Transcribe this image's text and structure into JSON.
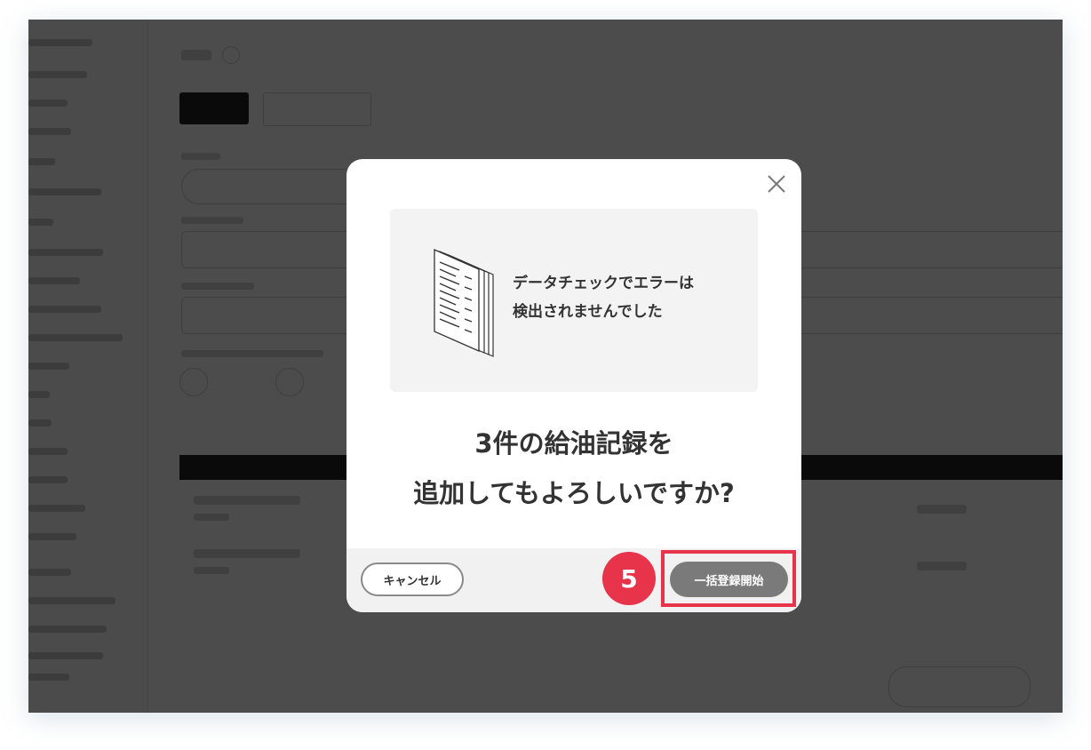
{
  "dialog": {
    "message_line1": "データチェックでエラーは",
    "message_line2": "検出されませんでした",
    "question_line1": "3件の給油記録を",
    "question_line2": "追加してもよろしいですか?",
    "cancel_label": "キャンセル",
    "confirm_label": "一括登録開始",
    "step_number": "5"
  },
  "icons": {
    "close": "close-icon",
    "document": "document-stack-icon"
  },
  "colors": {
    "accent_red": "#e8344a",
    "confirm_button": "#7a7a7a",
    "text_dark": "#333333"
  }
}
